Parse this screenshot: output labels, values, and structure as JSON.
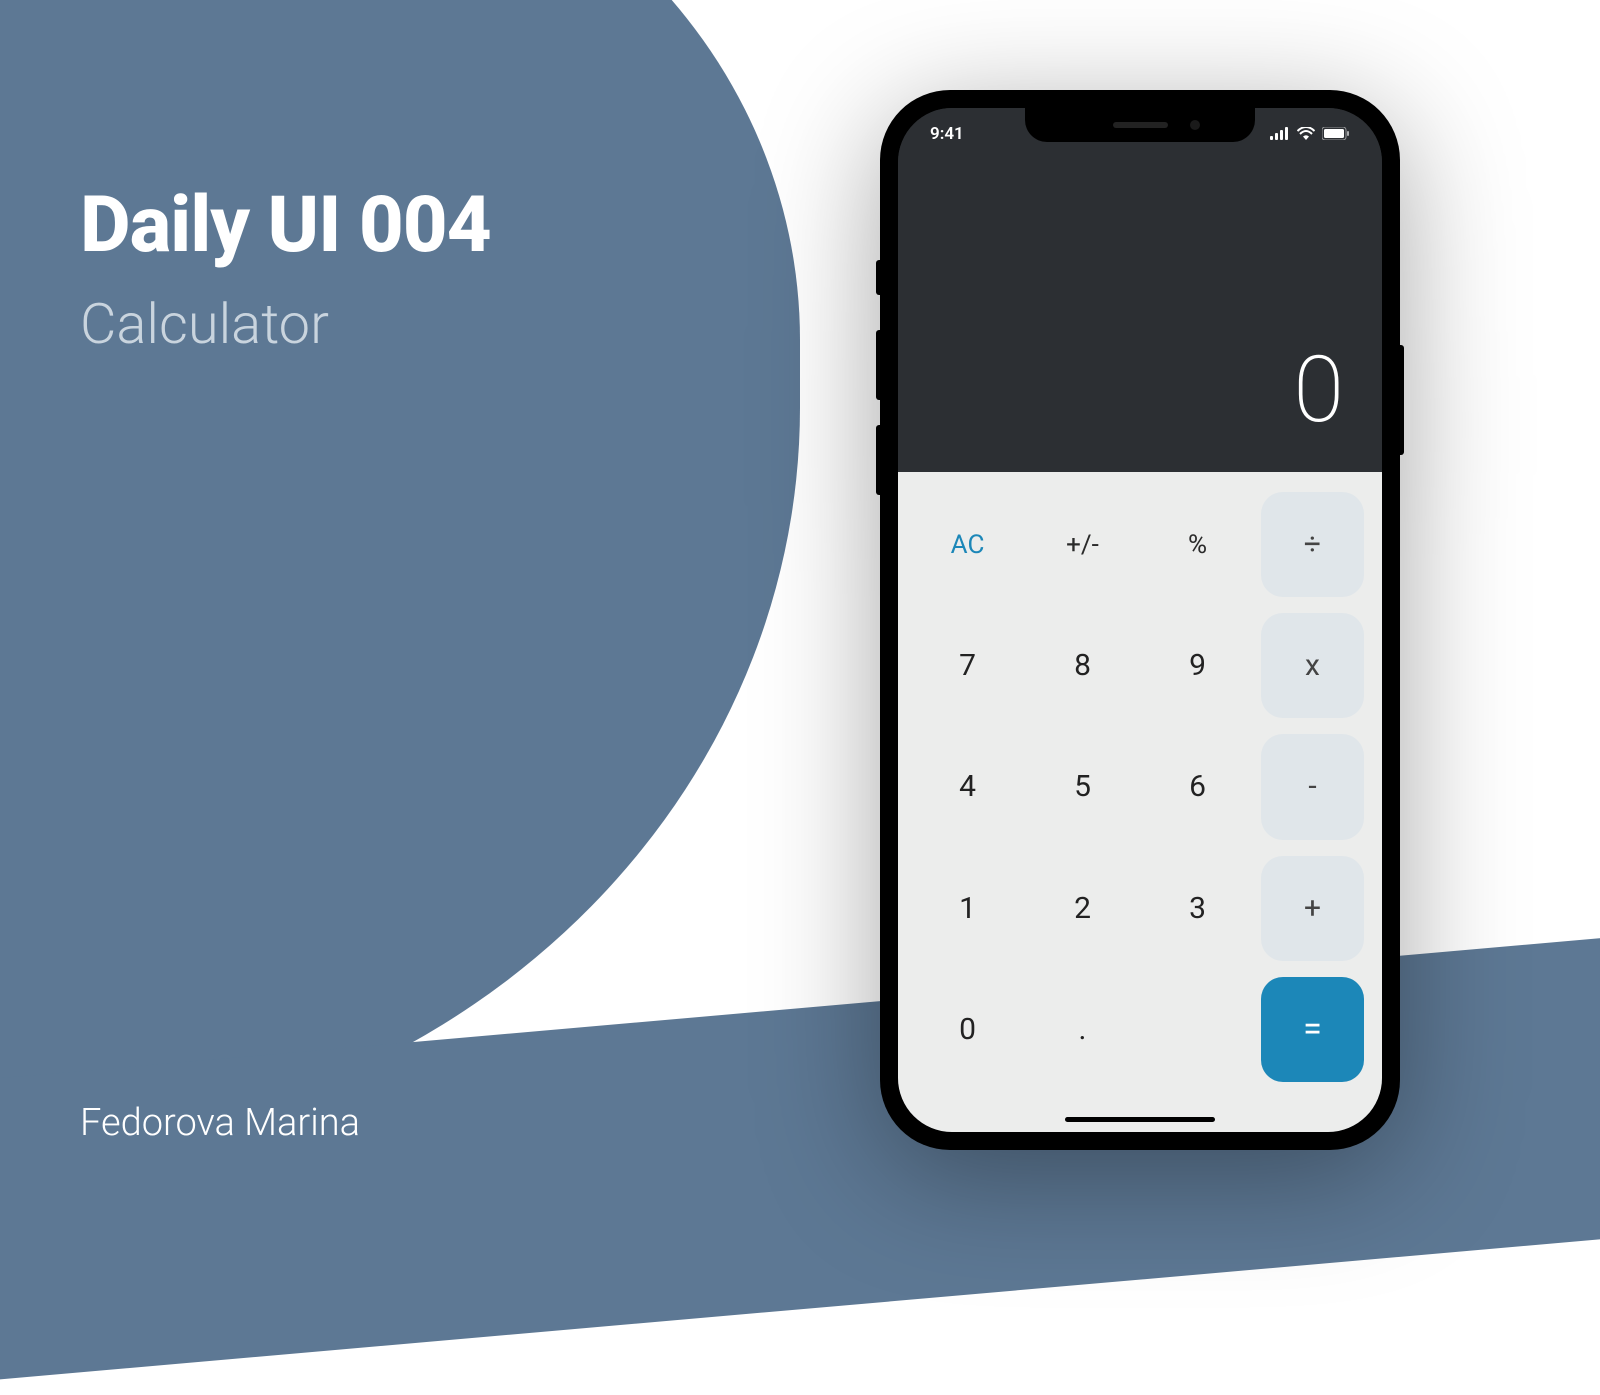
{
  "titles": {
    "main": "Daily UI 004",
    "sub": "Calculator"
  },
  "author": "Fedorova Marina",
  "status": {
    "time": "9:41"
  },
  "display": {
    "value": "0"
  },
  "keys": {
    "ac": "AC",
    "plusminus": "+/-",
    "percent": "%",
    "divide": "÷",
    "seven": "7",
    "eight": "8",
    "nine": "9",
    "multiply": "x",
    "four": "4",
    "five": "5",
    "six": "6",
    "minus": "-",
    "one": "1",
    "two": "2",
    "three": "3",
    "plus": "+",
    "zero": "0",
    "dot": ".",
    "equals": "="
  },
  "colors": {
    "accent": "#5d7894",
    "primary_action": "#1c87b8",
    "display_bg": "#2c2f33",
    "keypad_bg": "#ecedec"
  }
}
